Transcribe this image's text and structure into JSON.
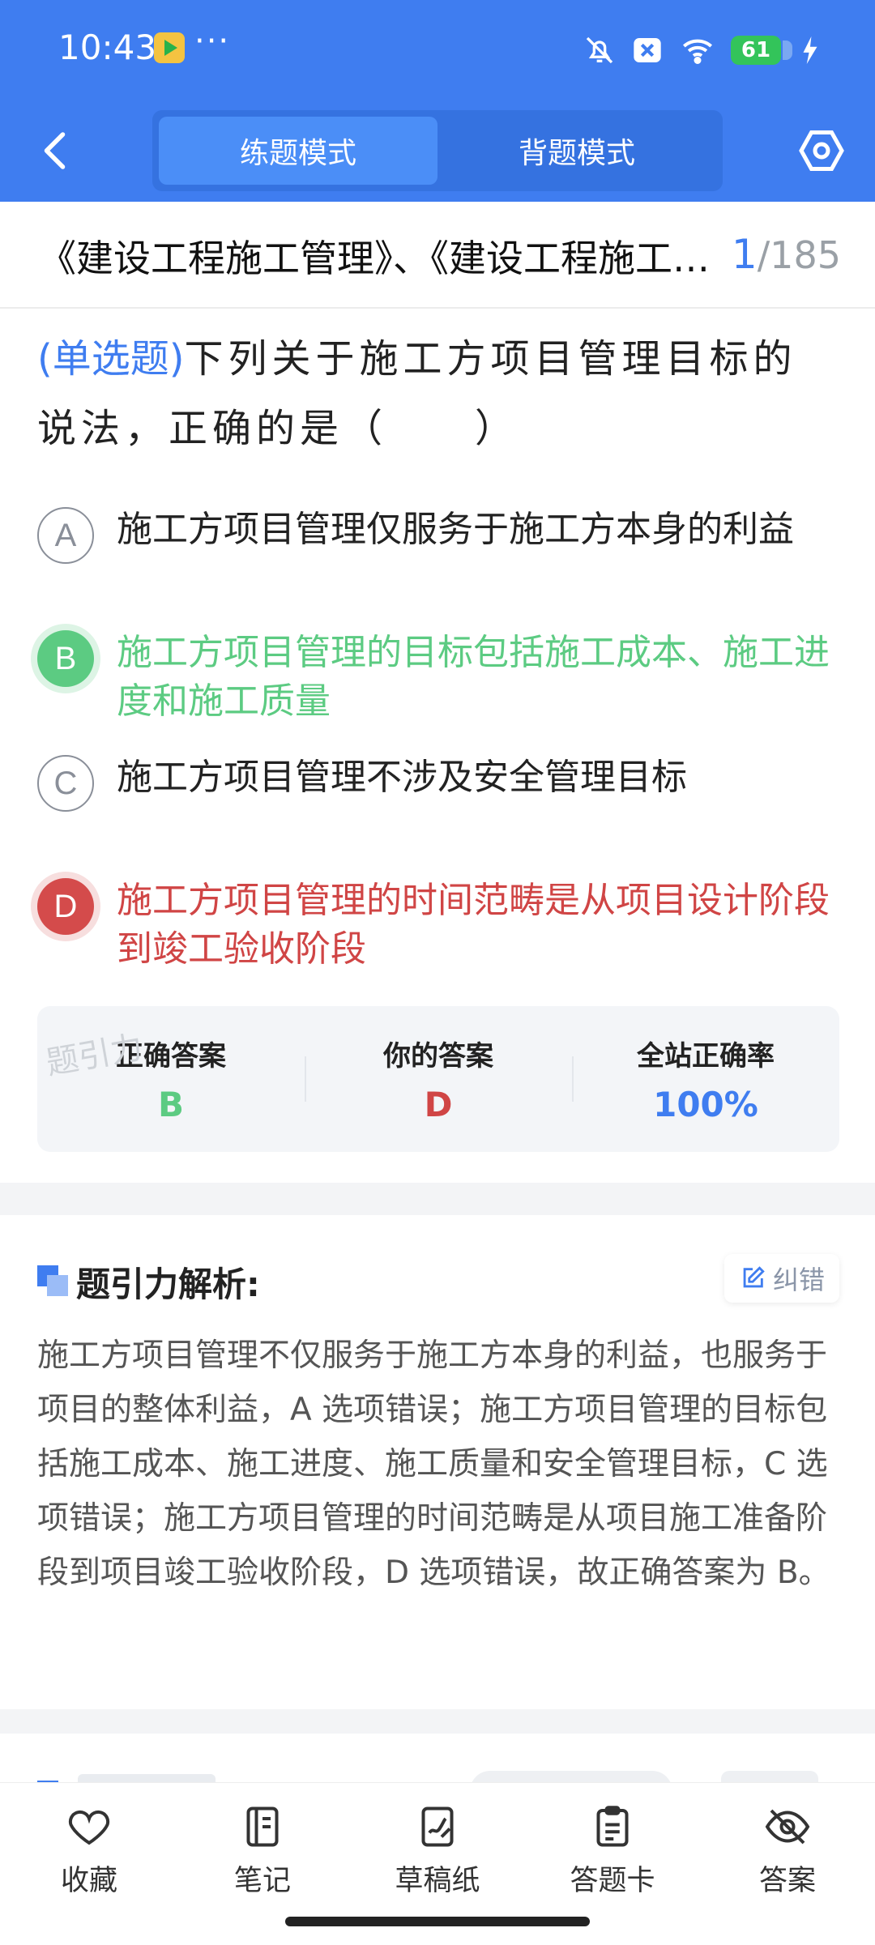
{
  "status_bar": {
    "time": "10:43",
    "more": "···",
    "battery": "61"
  },
  "nav": {
    "modes": [
      "练题模式",
      "背题模式"
    ],
    "active_mode": 0
  },
  "quiz": {
    "title": "《建设工程施工管理》、《建设工程施工管理》",
    "current": "1",
    "total": "/185"
  },
  "question": {
    "type": "(单选题)",
    "text": "下列关于施工方项目管理目标的说法，正确的是（　　）"
  },
  "options": [
    {
      "letter": "A",
      "text": "施工方项目管理仅服务于施工方本身的利益",
      "state": "normal"
    },
    {
      "letter": "B",
      "text": "施工方项目管理的目标包括施工成本、施工进度和施工质量",
      "state": "correct"
    },
    {
      "letter": "C",
      "text": "施工方项目管理不涉及安全管理目标",
      "state": "normal"
    },
    {
      "letter": "D",
      "text": "施工方项目管理的时间范畴是从项目设计阶段到竣工验收阶段",
      "state": "wrong"
    }
  ],
  "answer_summary": {
    "correct_label": "正确答案",
    "correct_value": "B",
    "yours_label": "你的答案",
    "yours_value": "D",
    "rate_label": "全站正确率",
    "rate_value": "100%",
    "watermark": "题引力"
  },
  "analysis": {
    "title": "题引力解析:",
    "report_label": "纠错",
    "body": "施工方项目管理不仅服务于施工方本身的利益，也服务于项目的整体利益，A 选项错误；施工方项目管理的目标包括施工成本、施工进度、施工质量和安全管理目标，C 选项错误；施工方项目管理的时间范畴是从项目施工准备阶段到项目竣工验收阶段，D 选项错误，故正确答案为 B。"
  },
  "bottom_bar": {
    "items": [
      {
        "label": "收藏",
        "icon": "heart-icon"
      },
      {
        "label": "笔记",
        "icon": "notebook-icon"
      },
      {
        "label": "草稿纸",
        "icon": "draft-paper-icon"
      },
      {
        "label": "答题卡",
        "icon": "answer-card-icon"
      },
      {
        "label": "答案",
        "icon": "eye-off-icon"
      }
    ]
  },
  "colors": {
    "primary": "#3f7df0",
    "correct": "#5ccb82",
    "wrong": "#d04545"
  }
}
